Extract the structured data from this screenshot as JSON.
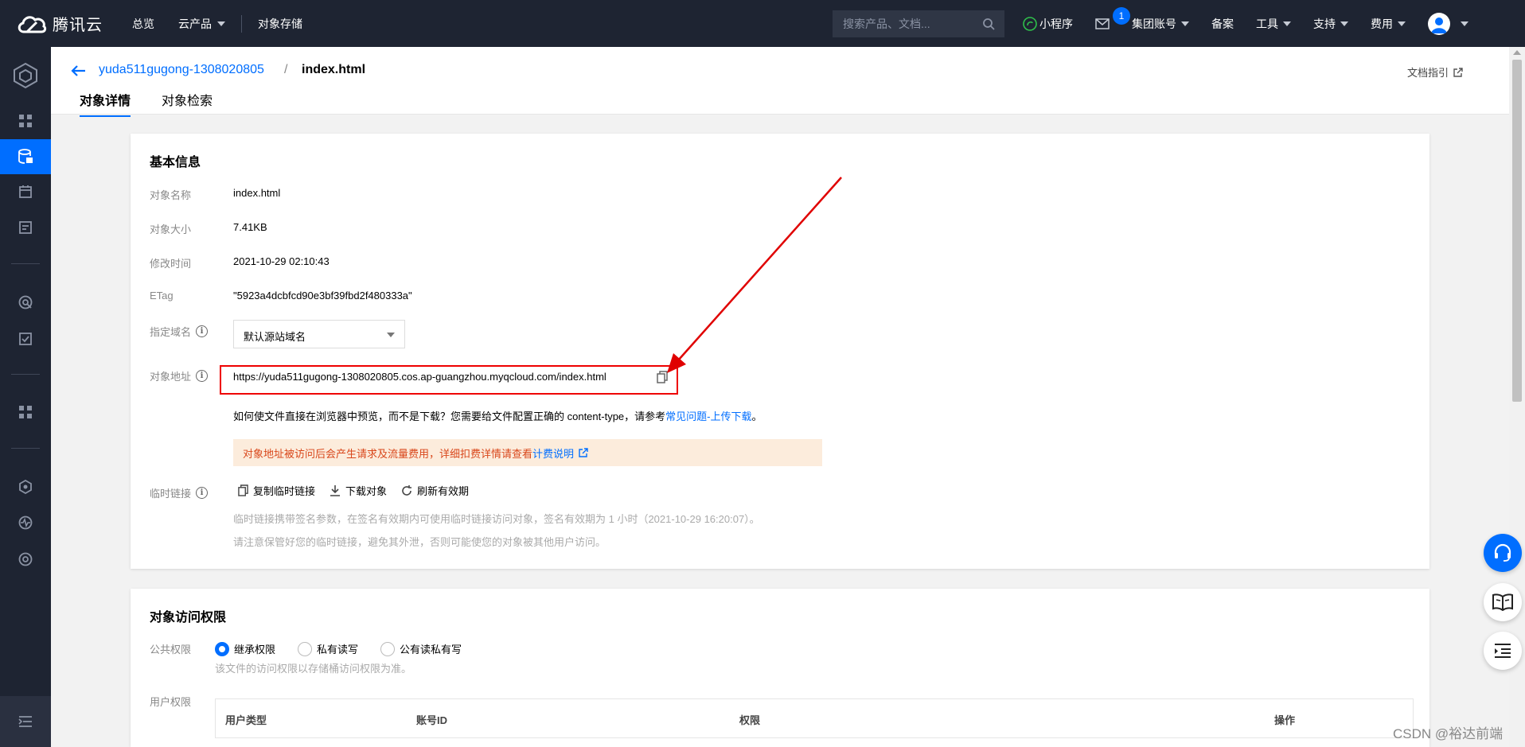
{
  "topnav": {
    "logo_text": "腾讯云",
    "items": [
      "总览",
      "云产品",
      "对象存储"
    ],
    "search_placeholder": "搜索产品、文档...",
    "mini_program": "小程序",
    "mail_badge": "1",
    "group_account": "集团账号",
    "filing": "备案",
    "tools": "工具",
    "support": "支持",
    "billing": "费用"
  },
  "header": {
    "bucket": "yuda511gugong-1308020805",
    "separator": "/",
    "object": "index.html",
    "doc_guide": "文档指引",
    "tabs": [
      "对象详情",
      "对象检索"
    ]
  },
  "basic_info": {
    "title": "基本信息",
    "name_label": "对象名称",
    "name_value": "index.html",
    "size_label": "对象大小",
    "size_value": "7.41KB",
    "mtime_label": "修改时间",
    "mtime_value": "2021-10-29 02:10:43",
    "etag_label": "ETag",
    "etag_value": "\"5923a4dcbfcd90e3bf39fbd2f480333a\"",
    "domain_label": "指定域名",
    "domain_value": "默认源站域名",
    "url_label": "对象地址",
    "url_value": "https://yuda511gugong-1308020805.cos.ap-guangzhou.myqcloud.com/index.html",
    "hint_text": "如何使文件直接在浏览器中预览，而不是下载？您需要给文件配置正确的 content-type，请参考",
    "hint_link": "常见问题-上传下载",
    "hint_end": "。",
    "warn_text": "对象地址被访问后会产生请求及流量费用，详细扣费详情请查看",
    "warn_link": "计费说明",
    "temp_label": "临时链接",
    "actions": [
      "复制临时链接",
      "下载对象",
      "刷新有效期"
    ],
    "note1": "临时链接携带签名参数，在签名有效期内可使用临时链接访问对象，签名有效期为 1 小时（2021-10-29 16:20:07）。",
    "note2": "请注意保管好您的临时链接，避免其外泄，否则可能使您的对象被其他用户访问。"
  },
  "permissions": {
    "title": "对象访问权限",
    "public_label": "公共权限",
    "options": [
      "继承权限",
      "私有读写",
      "公有读私有写"
    ],
    "selected": "继承权限",
    "public_hint": "该文件的访问权限以存储桶访问权限为准。",
    "user_label": "用户权限",
    "columns": [
      "用户类型",
      "账号ID",
      "权限",
      "操作"
    ]
  },
  "watermark": "CSDN @裕达前端",
  "colors": {
    "accent": "#006eff",
    "nav_bg": "#1e2432",
    "highlight": "#e00000",
    "warn_bg": "#fcecdc",
    "warn_text": "#d9471b"
  }
}
